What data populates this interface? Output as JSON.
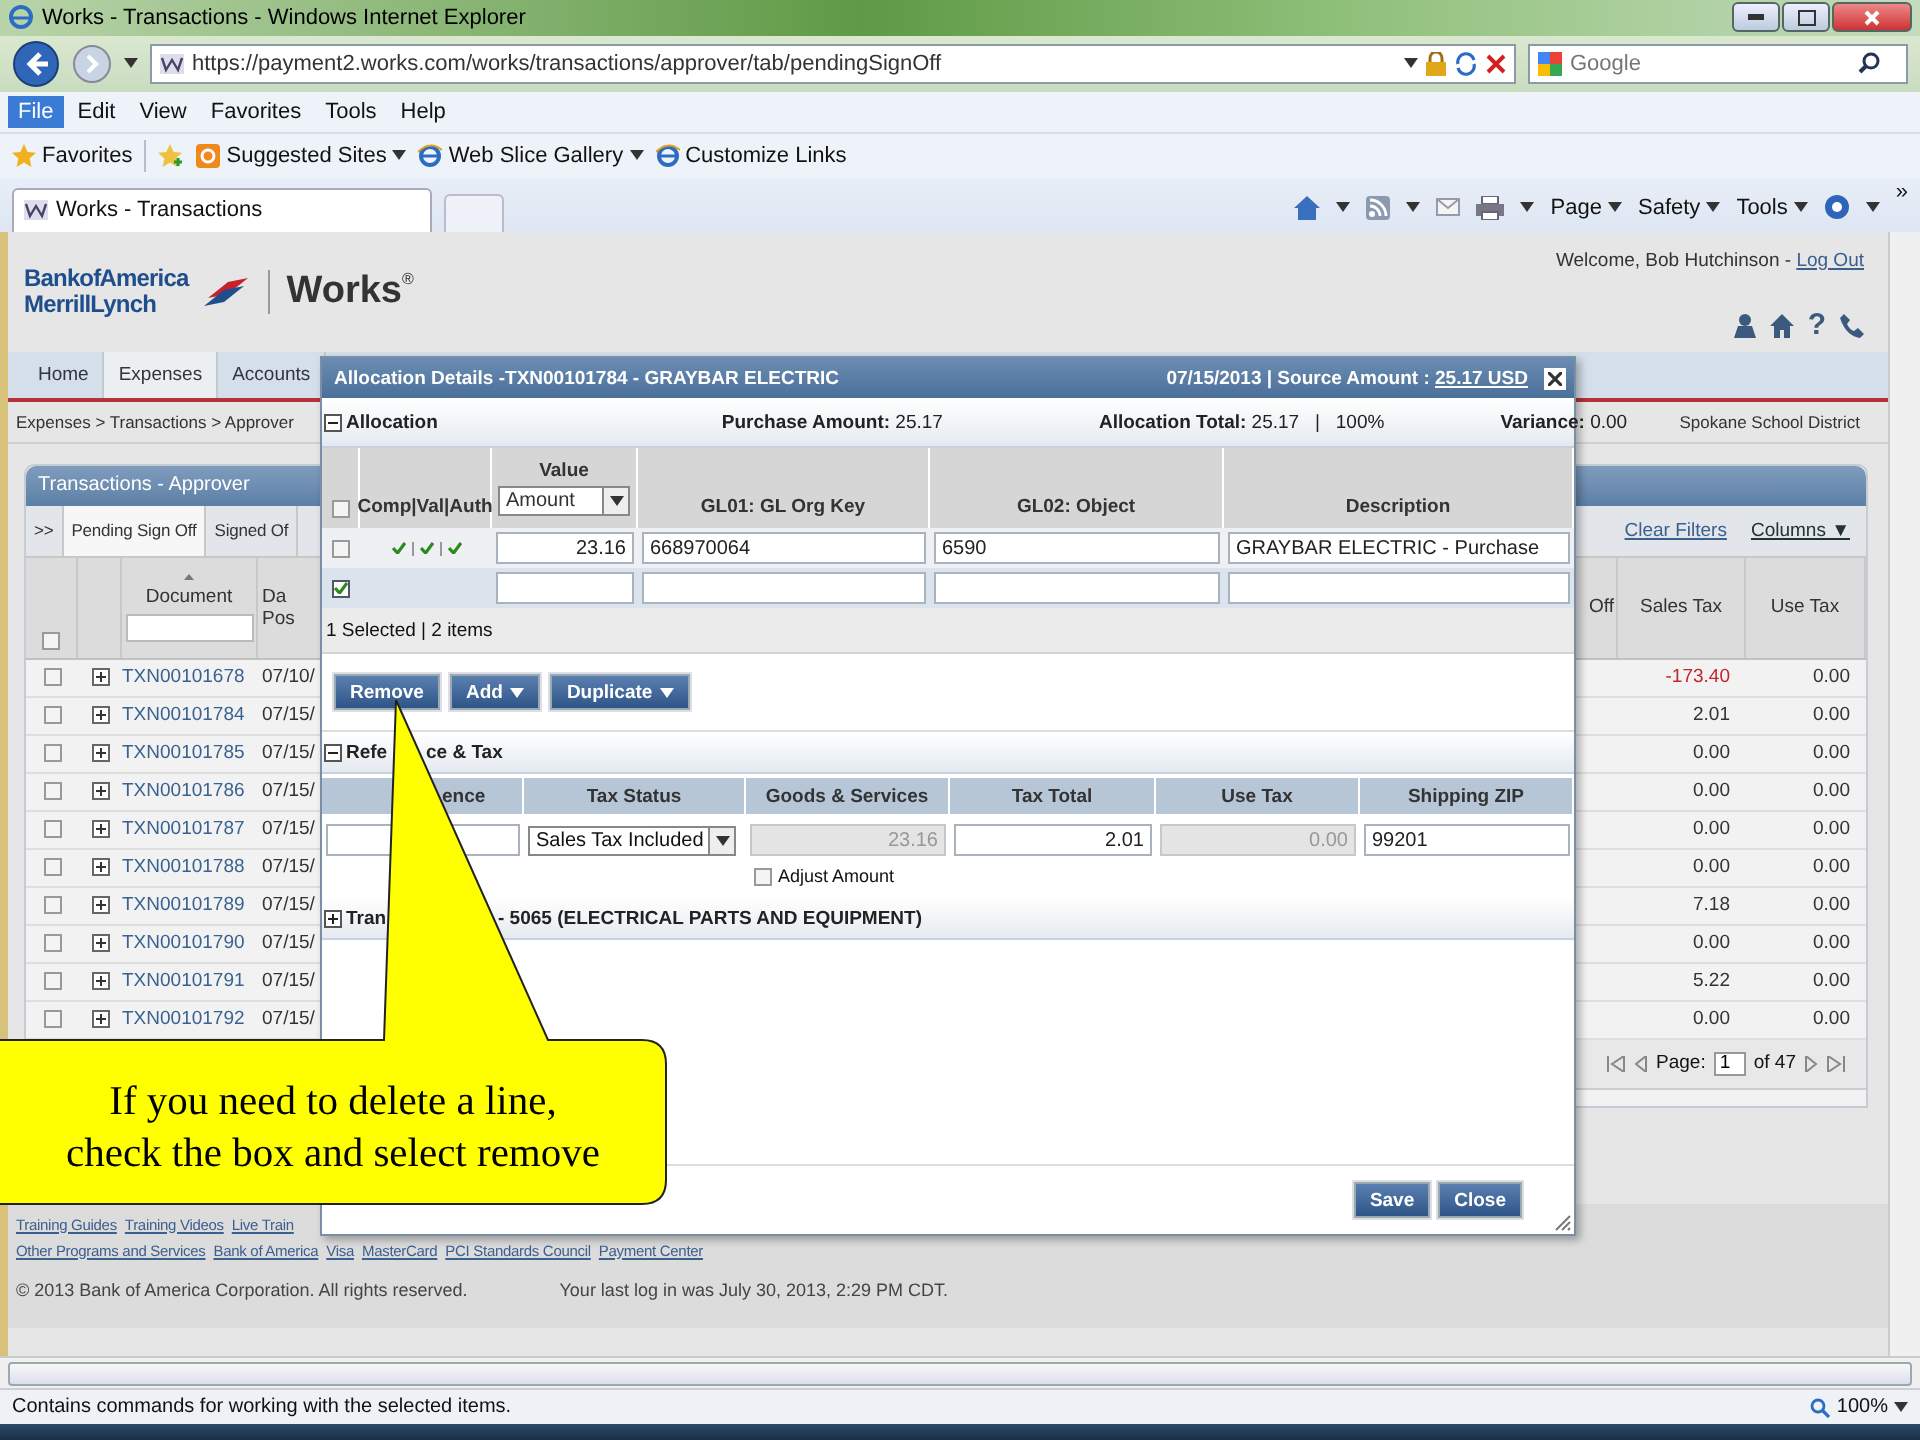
{
  "window": {
    "title": "Works - Transactions - Windows Internet Explorer"
  },
  "address_bar": {
    "url": "https://payment2.works.com/works/transactions/approver/tab/pendingSignOff"
  },
  "search": {
    "placeholder": "Google"
  },
  "menu": [
    {
      "label": "File",
      "selected": true
    },
    {
      "label": "Edit",
      "selected": false
    },
    {
      "label": "View",
      "selected": false
    },
    {
      "label": "Favorites",
      "selected": false
    },
    {
      "label": "Tools",
      "selected": false
    },
    {
      "label": "Help",
      "selected": false
    }
  ],
  "favorites_bar": {
    "favorites": "Favorites",
    "links": [
      {
        "label": "Suggested Sites",
        "dropdown": true,
        "kind": "suggested"
      },
      {
        "label": "Web Slice Gallery",
        "dropdown": true,
        "kind": "ie"
      },
      {
        "label": "Customize Links",
        "dropdown": false,
        "kind": "ie"
      }
    ]
  },
  "tab": {
    "title": "Works - Transactions"
  },
  "command_bar": {
    "more": "»",
    "items": [
      {
        "label": "Page"
      },
      {
        "label": "Safety"
      },
      {
        "label": "Tools"
      }
    ]
  },
  "header": {
    "brand": [
      "Bank of America",
      "Merrill Lynch"
    ],
    "product": "Works",
    "product_mark": "®",
    "welcome": "Welcome, Bob Hutchinson - ",
    "logout": "Log Out",
    "help": "?"
  },
  "nav": [
    {
      "label": "Home",
      "selected": false
    },
    {
      "label": "Expenses",
      "selected": true
    },
    {
      "label": "Accounts",
      "selected": false
    }
  ],
  "breadcrumb": "Expenses > Transactions > Approver",
  "district": "Spokane School District",
  "panel": {
    "title": "Transactions - Approver",
    "tabs": [
      {
        "label": ">>",
        "selected": false
      },
      {
        "label": "Pending Sign Off",
        "selected": true
      },
      {
        "label": "Signed Of",
        "selected": false
      }
    ],
    "select_all": {
      "checked": false
    },
    "clear_filters": "Clear Filters",
    "columns_menu": "Columns ▼",
    "columns": {
      "document": "Document",
      "date": "Da Pos",
      "cut": "Off",
      "sales_tax": "Sales Tax",
      "use_tax": "Use Tax"
    },
    "rows": [
      {
        "checked": false,
        "document": "TXN00101678",
        "date": "07/10/",
        "sales_tax": "-173.40",
        "negative": true,
        "use_tax": "0.00"
      },
      {
        "checked": false,
        "document": "TXN00101784",
        "date": "07/15/",
        "sales_tax": "2.01",
        "negative": false,
        "use_tax": "0.00"
      },
      {
        "checked": false,
        "document": "TXN00101785",
        "date": "07/15/",
        "sales_tax": "0.00",
        "negative": false,
        "use_tax": "0.00"
      },
      {
        "checked": false,
        "document": "TXN00101786",
        "date": "07/15/",
        "sales_tax": "0.00",
        "negative": false,
        "use_tax": "0.00"
      },
      {
        "checked": false,
        "document": "TXN00101787",
        "date": "07/15/",
        "sales_tax": "0.00",
        "negative": false,
        "use_tax": "0.00"
      },
      {
        "checked": false,
        "document": "TXN00101788",
        "date": "07/15/",
        "sales_tax": "0.00",
        "negative": false,
        "use_tax": "0.00"
      },
      {
        "checked": false,
        "document": "TXN00101789",
        "date": "07/15/",
        "sales_tax": "7.18",
        "negative": false,
        "use_tax": "0.00"
      },
      {
        "checked": false,
        "document": "TXN00101790",
        "date": "07/15/",
        "sales_tax": "0.00",
        "negative": false,
        "use_tax": "0.00"
      },
      {
        "checked": false,
        "document": "TXN00101791",
        "date": "07/15/",
        "sales_tax": "5.22",
        "negative": false,
        "use_tax": "0.00"
      },
      {
        "checked": false,
        "document": "TXN00101792",
        "date": "07/15/",
        "sales_tax": "0.00",
        "negative": false,
        "use_tax": "0.00"
      }
    ],
    "pager": {
      "label": "Page:",
      "page": "1",
      "of": "of 47"
    }
  },
  "dialog": {
    "title": "Allocation Details -TXN00101784 - GRAYBAR ELECTRIC",
    "source": "07/15/2013 | Source Amount : ",
    "source_amount": "25.17 USD",
    "allocation": {
      "title": "Allocation",
      "expanded": true,
      "purchase": "**Purchase Amount:** 25.17",
      "total": "**Allocation Total:** 25.17   |   100%",
      "variance": "**Variance:** 0.00",
      "select_all": {
        "checked": false
      },
      "columns": [
        "Comp|Val|Auth",
        "Value",
        "GL01: GL Org Key",
        "GL02: Object",
        "Description"
      ],
      "value_type": "Amount",
      "rows": [
        {
          "checked": false,
          "comp": true,
          "val": true,
          "auth": true,
          "value": "23.16",
          "gl01": "668970064",
          "gl02": "6590",
          "description": "GRAYBAR ELECTRIC - Purchase"
        },
        {
          "checked": true,
          "comp": false,
          "val": false,
          "auth": false
        }
      ],
      "info": "1 Selected | 2 items",
      "buttons": [
        {
          "label": "Remove",
          "dropdown": false
        },
        {
          "label": "Add",
          "dropdown": true
        },
        {
          "label": "Duplicate",
          "dropdown": true
        }
      ]
    },
    "reference": {
      "title_parts": [
        "Refe",
        "ce & Tax"
      ],
      "expanded": true,
      "columns": [
        "ence",
        "Tax Status",
        "Goods & Services",
        "Tax Total",
        "Use Tax",
        "Shipping ZIP"
      ],
      "fields": [
        {
          "kind": "text",
          "disabled": false
        },
        {
          "kind": "select",
          "value": "Sales Tax Included",
          "disabled": false
        },
        {
          "kind": "amount",
          "value": "23.16",
          "disabled": true
        },
        {
          "kind": "amount",
          "value": "2.01",
          "disabled": false
        },
        {
          "kind": "amount",
          "value": "0.00",
          "disabled": true
        },
        {
          "kind": "text",
          "value": "99201",
          "disabled": false
        }
      ],
      "adjust": {
        "label": "Adjust Amount",
        "checked": false
      }
    },
    "transaction": {
      "title_parts": [
        "Tran",
        "- 5065 (ELECTRICAL PARTS AND EQUIPMENT)"
      ],
      "expanded": false
    },
    "buttons": [
      "Save",
      "Close"
    ]
  },
  "callout": {
    "text": "If  you need to delete a line,\ncheck the box and select remove"
  },
  "footer": {
    "links": [
      [
        "Training Guides",
        "Training Videos",
        "Live Train"
      ],
      [
        "Other Programs and Services",
        "Bank of America",
        "Visa",
        "MasterCard",
        "PCI Standards Council",
        "Payment Center"
      ]
    ],
    "copyright": "© 2013 Bank of America Corporation. All rights reserved.",
    "last_login": "Your last log in was July 30, 2013, 2:29 PM CDT."
  },
  "status_bar": {
    "text": "Contains commands for working with the selected items.",
    "zoom": "100%"
  }
}
